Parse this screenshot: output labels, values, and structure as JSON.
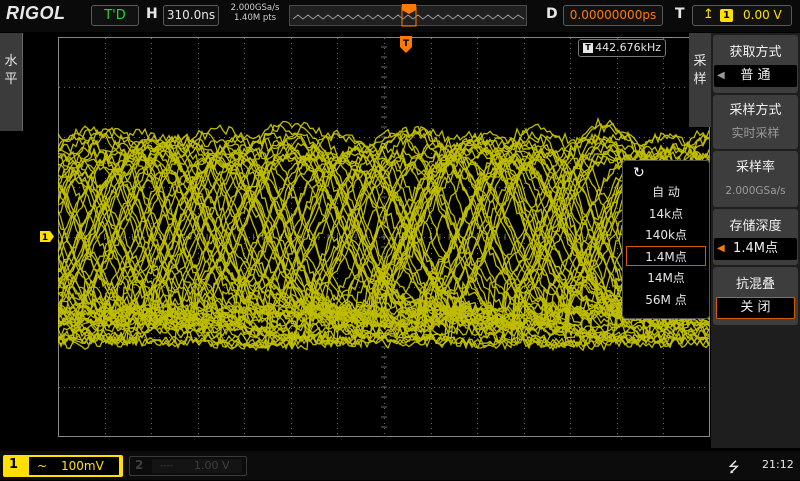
{
  "header": {
    "brand": "RIGOL",
    "run_state": "T'D",
    "h_label": "H",
    "timebase": "310.0ns",
    "sample_rate": "2.000GSa/s",
    "memory_points": "1.40M pts",
    "delay_label": "D",
    "delay_value": "0.00000000ps",
    "trigger_label": "T",
    "trigger_channel": "1",
    "trigger_level": "0.00 V"
  },
  "left_tab": {
    "label_1": "水",
    "label_2": "平"
  },
  "side_tab": {
    "label_1": "采",
    "label_2": "样"
  },
  "frequency_readout": {
    "icon": "T",
    "value": "442.676kHz"
  },
  "trigger_marker": {
    "label": "T"
  },
  "ch1_marker": {
    "label": "1"
  },
  "popup": {
    "icon": "rotate-knob-icon",
    "items": [
      "自 动",
      "14k点",
      "140k点",
      "1.4M点",
      "14M点",
      "56M 点"
    ],
    "selected_index": 3
  },
  "right_menu": {
    "items": [
      {
        "title": "获取方式",
        "value": "普  通"
      },
      {
        "title": "采样方式",
        "value": "实时采样"
      },
      {
        "title": "采样率",
        "value": "2.000GSa/s"
      },
      {
        "title": "存储深度",
        "value": "1.4M点"
      },
      {
        "title": "抗混叠",
        "value": "关  闭"
      }
    ]
  },
  "bottom": {
    "ch1_num": "1",
    "ch1_coupling": "~",
    "ch1_scale": "100mV",
    "ch2_num": "2",
    "ch2_coupling": "----",
    "ch2_scale": "1.00 V",
    "clock": "21:12"
  },
  "colors": {
    "ch1_trace": "#e0dd00",
    "accent_orange": "#ff7a00",
    "run_green": "#22d43a",
    "menu_bg": "#1e1e1e",
    "grid": "#6a6a6a"
  }
}
